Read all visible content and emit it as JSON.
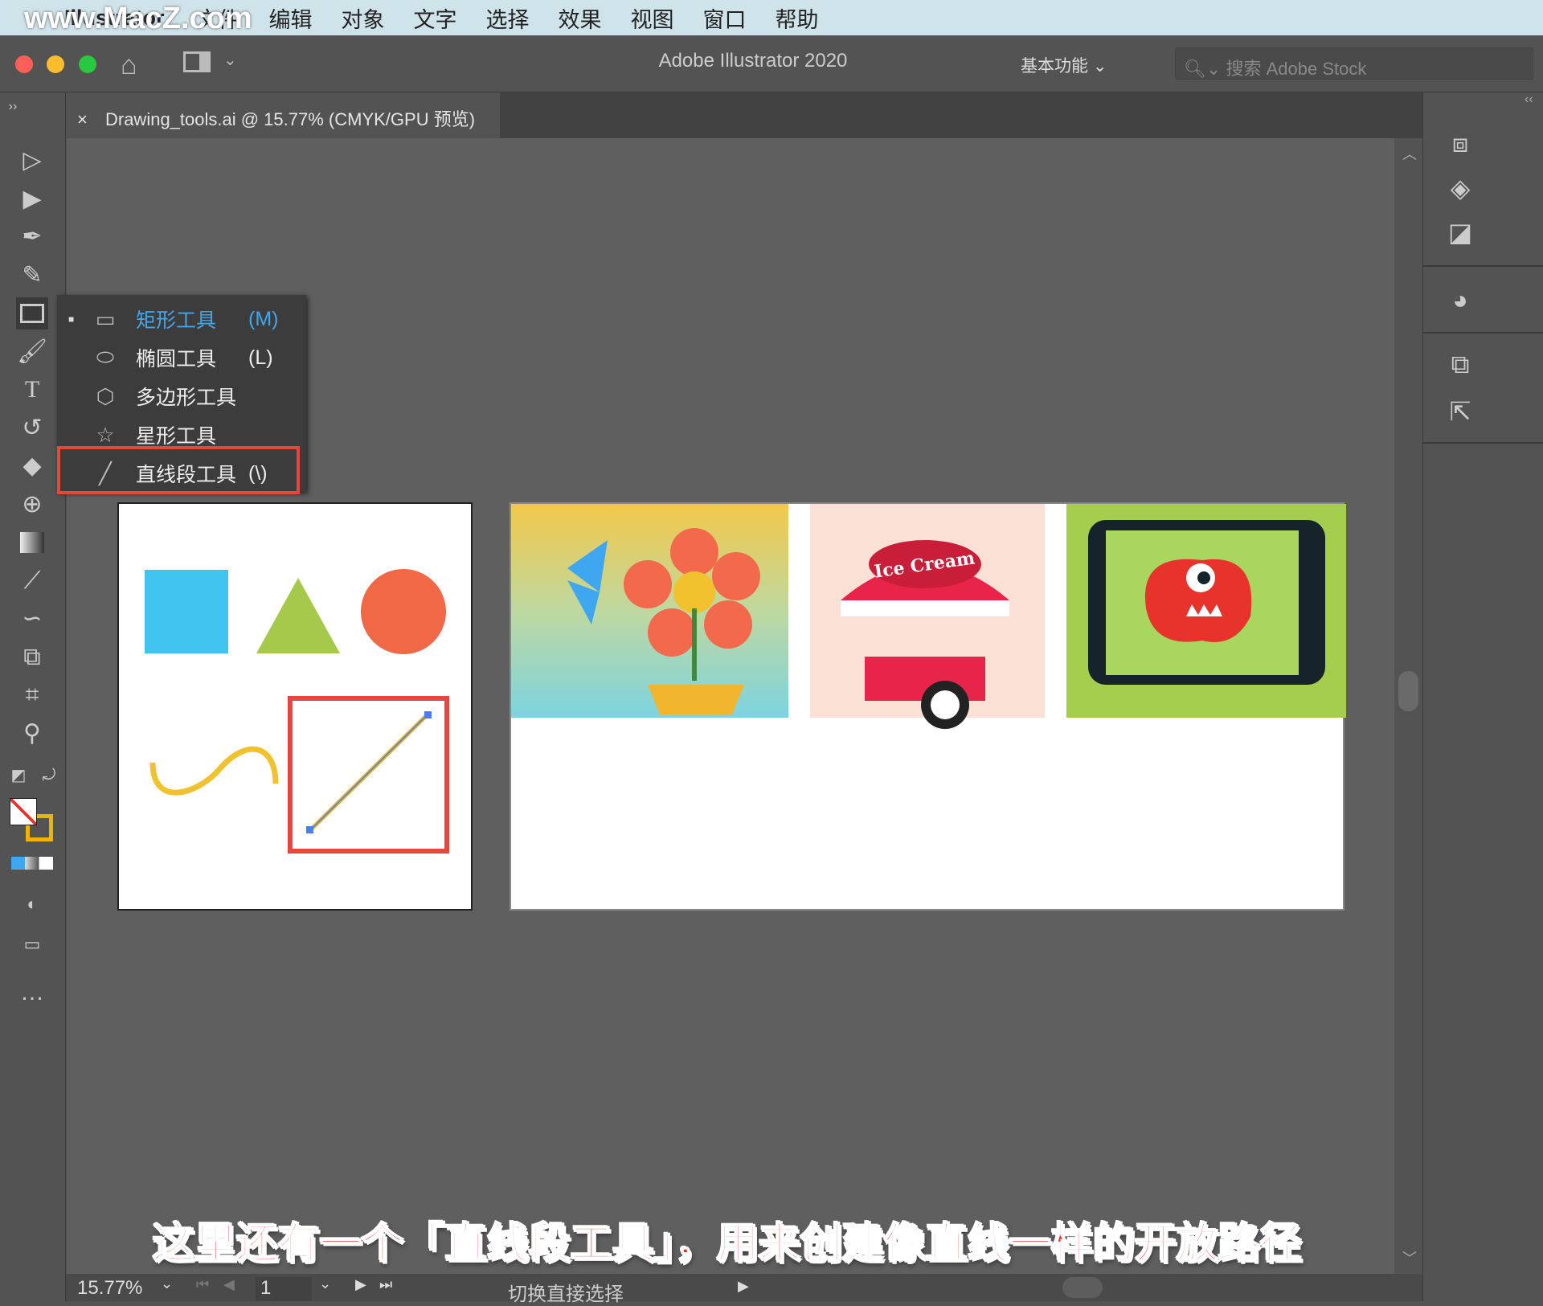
{
  "menubar": {
    "app": "Illustrator",
    "items": [
      "文件",
      "编辑",
      "对象",
      "文字",
      "选择",
      "效果",
      "视图",
      "窗口",
      "帮助"
    ],
    "watermark": "www.MacZ.com"
  },
  "titlebar": {
    "title": "Adobe Illustrator 2020",
    "workspace": "基本功能",
    "search_placeholder": "搜索 Adobe Stock"
  },
  "document_tab": {
    "title": "Drawing_tools.ai @ 15.77% (CMYK/GPU 预览)",
    "close": "×"
  },
  "flyout": {
    "items": [
      {
        "label": "矩形工具",
        "shortcut": "(M)",
        "icon": "rectangle-icon",
        "active": true
      },
      {
        "label": "椭圆工具",
        "shortcut": "(L)",
        "icon": "ellipse-icon"
      },
      {
        "label": "多边形工具",
        "shortcut": "",
        "icon": "polygon-icon"
      },
      {
        "label": "星形工具",
        "shortcut": "",
        "icon": "star-icon"
      },
      {
        "label": "直线段工具",
        "shortcut": "(\\)",
        "icon": "line-segment-icon",
        "highlighted": true
      }
    ]
  },
  "artwork": {
    "ice_cream_sign": "Ice Cream"
  },
  "statusbar": {
    "zoom": "15.77%",
    "page": "1",
    "status": "切换直接选择"
  },
  "caption": "这里还有一个「直线段工具」，用来创建像直线一样的开放路径",
  "colors": {
    "highlight": "#e8453c",
    "accent_blue": "#3ea7f0",
    "canvas": "#5f5f5f"
  }
}
